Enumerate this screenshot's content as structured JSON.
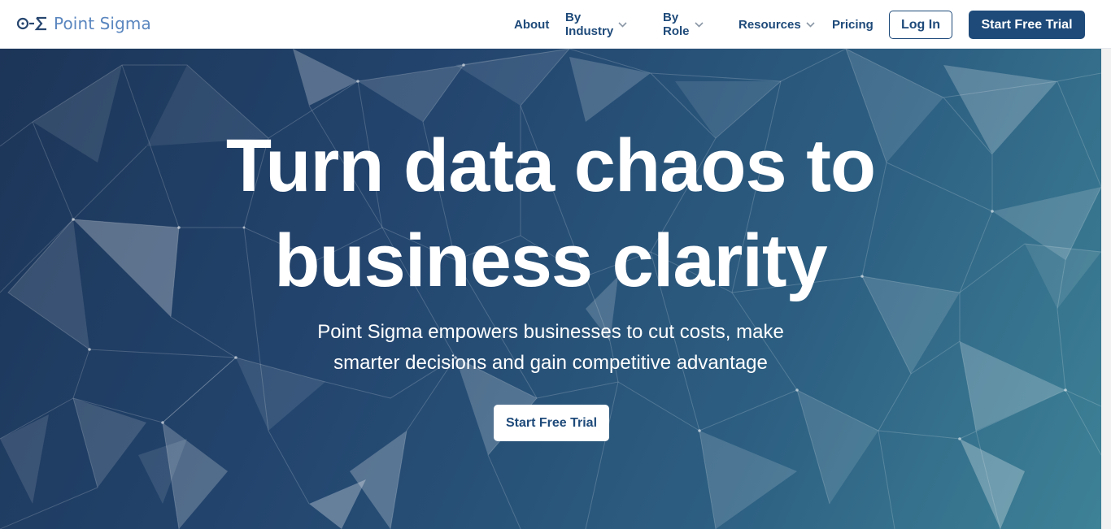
{
  "brand": {
    "name": "Point Sigma",
    "logo_icon": "point-sigma-logo-icon",
    "accent": "#1e4a7a",
    "logo_color": "#5a86bf"
  },
  "nav": {
    "about": "About",
    "industry": "By Industry",
    "role": "By Role",
    "resources": "Resources",
    "pricing": "Pricing",
    "dropdown_icon": "chevron-down-icon"
  },
  "header_actions": {
    "login": "Log In",
    "trial": "Start Free Trial"
  },
  "hero": {
    "title_line1": "Turn data chaos to",
    "title_line2": "business clarity",
    "subtitle_line1": "Point Sigma empowers businesses to cut costs, make",
    "subtitle_line2": "smarter decisions and gain competitive advantage",
    "cta": "Start Free Trial",
    "background": "polygon-network-background"
  }
}
